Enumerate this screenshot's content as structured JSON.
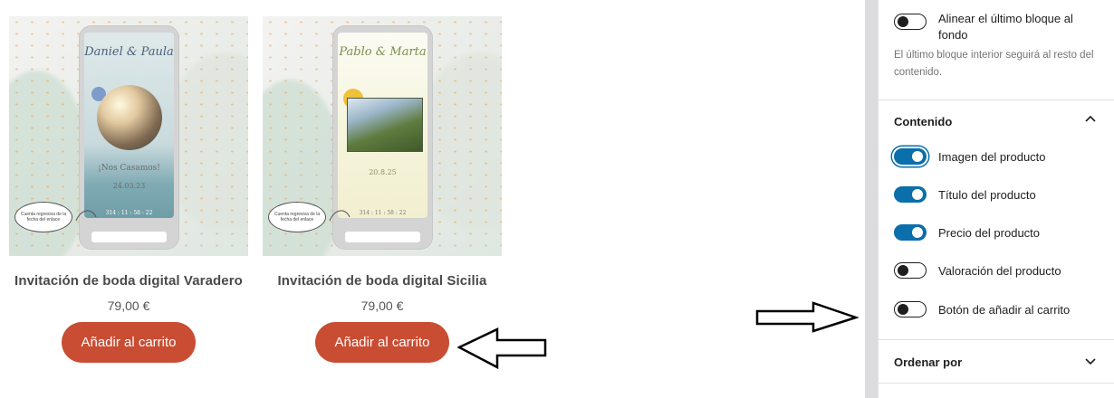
{
  "products": [
    {
      "title": "Invitación de boda digital Varadero",
      "price": "79,00 €",
      "button": "Añadir al carrito",
      "image": {
        "names": "Daniel & Paula",
        "headline": "¡Nos Casamos!",
        "date": "24.03.23",
        "countdown": "314 : 11 : 58 : 22",
        "bubble": "Cuenta regresiva de la fecha del enlace"
      }
    },
    {
      "title": "Invitación de boda digital Sicilia",
      "price": "79,00 €",
      "button": "Añadir al carrito",
      "image": {
        "names": "Pablo & Marta",
        "headline": "",
        "date": "20.8.25",
        "countdown": "314 : 11 : 58 : 22",
        "bubble": "Cuenta regresiva de la fecha del enlace"
      }
    }
  ],
  "sidebar": {
    "align_last_block": {
      "label": "Alinear el último bloque al fondo",
      "help": "El último bloque interior seguirá al resto del contenido.",
      "enabled": false
    },
    "content_section": {
      "title": "Contenido",
      "toggles": [
        {
          "label": "Imagen del producto",
          "enabled": true
        },
        {
          "label": "Título del producto",
          "enabled": true
        },
        {
          "label": "Precio del producto",
          "enabled": true
        },
        {
          "label": "Valoración del producto",
          "enabled": false
        },
        {
          "label": "Botón de añadir al carrito",
          "enabled": false
        }
      ]
    },
    "order_section": {
      "title": "Ordenar por"
    }
  },
  "icons": {
    "collapse": "chevron-up-icon",
    "expand": "chevron-down-icon",
    "annotation_left": "arrow-left-outline-icon",
    "annotation_right": "arrow-right-outline-icon"
  },
  "colors": {
    "button": "#c94d33",
    "toggle_on": "#0a6fab",
    "text": "#1e1e1e"
  }
}
